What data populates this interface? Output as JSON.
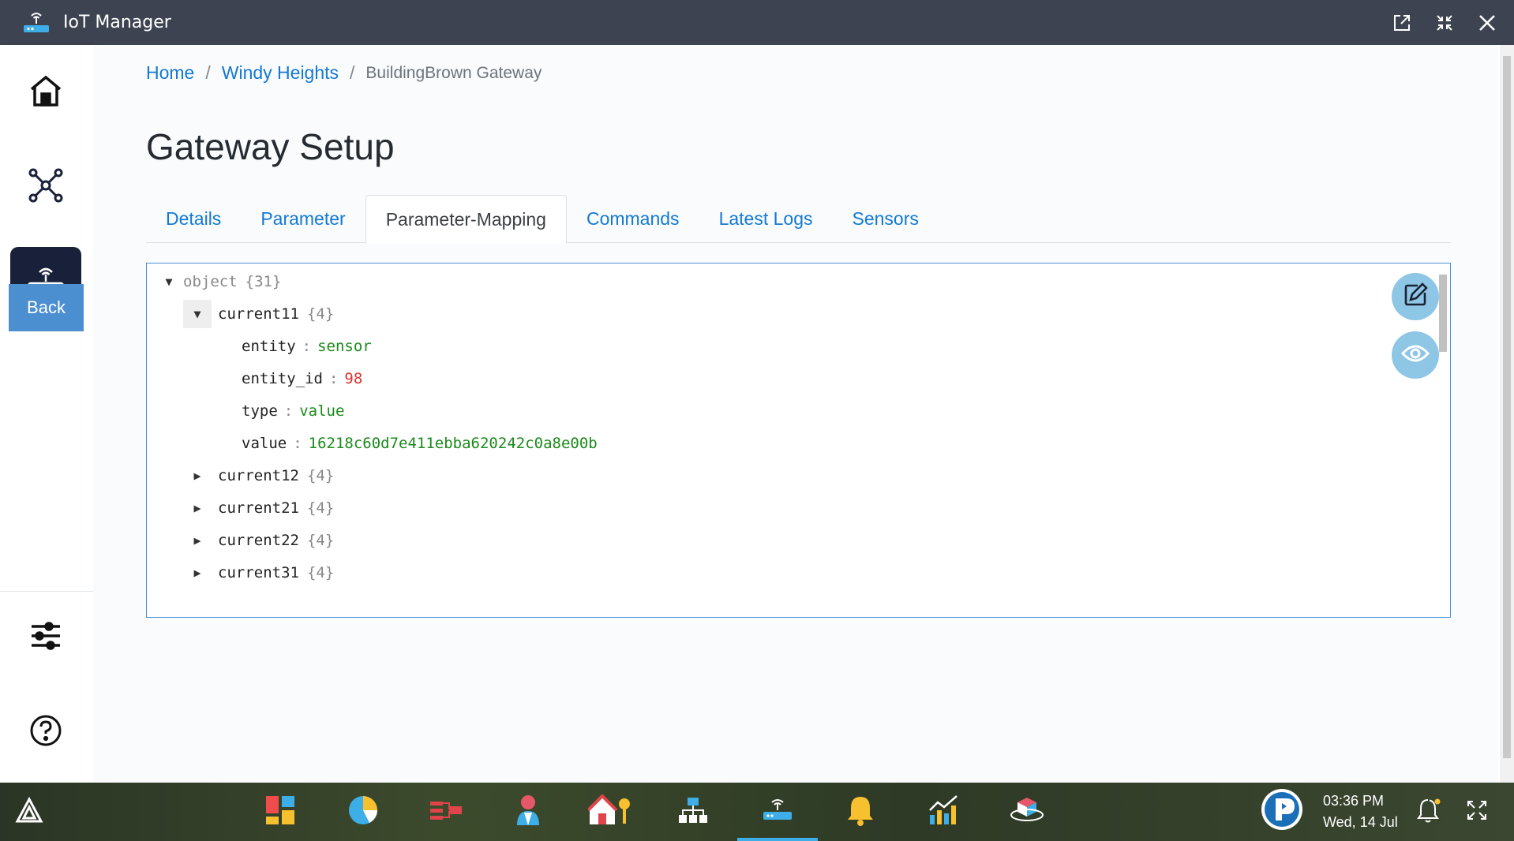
{
  "window": {
    "title": "IoT Manager",
    "controls": [
      "popout-icon",
      "compress-icon",
      "close-icon"
    ]
  },
  "sidebar": {
    "items": [
      {
        "name": "home",
        "icon": "home-icon"
      },
      {
        "name": "network",
        "icon": "network-icon"
      },
      {
        "name": "gateway",
        "icon": "router-icon",
        "active": true
      }
    ],
    "back_label": "Back",
    "bottom_items": [
      {
        "name": "settings",
        "icon": "sliders-icon"
      },
      {
        "name": "help",
        "icon": "help-icon"
      }
    ]
  },
  "breadcrumb": {
    "home": "Home",
    "site": "Windy Heights",
    "current": "BuildingBrown Gateway",
    "separator": "/"
  },
  "page_title": "Gateway Setup",
  "tabs": [
    {
      "label": "Details"
    },
    {
      "label": "Parameter"
    },
    {
      "label": "Parameter-Mapping",
      "active": true
    },
    {
      "label": "Commands"
    },
    {
      "label": "Latest Logs"
    },
    {
      "label": "Sensors"
    }
  ],
  "json_viewer": {
    "root_label": "object",
    "root_count": "{31}",
    "expanded": {
      "key": "current11",
      "count": "{4}",
      "fields": [
        {
          "key": "entity",
          "value": "sensor",
          "kind": "string"
        },
        {
          "key": "entity_id",
          "value": "98",
          "kind": "number"
        },
        {
          "key": "type",
          "value": "value",
          "kind": "string"
        },
        {
          "key": "value",
          "value": "16218c60d7e411ebba620242c0a8e00b",
          "kind": "string"
        }
      ]
    },
    "collapsed": [
      {
        "key": "current12",
        "count": "{4}"
      },
      {
        "key": "current21",
        "count": "{4}"
      },
      {
        "key": "current22",
        "count": "{4}"
      },
      {
        "key": "current31",
        "count": "{4}"
      }
    ],
    "tools": [
      "edit-icon",
      "eye-icon"
    ]
  },
  "taskbar": {
    "apps": [
      "start-icon",
      "dashboard-icon",
      "analytics-icon",
      "flow-icon",
      "user-icon",
      "home-key-icon",
      "hierarchy-icon",
      "gateway-icon",
      "bell-app-icon",
      "chart-icon",
      "cube-icon"
    ],
    "time": "03:36 PM",
    "date": "Wed, 14 Jul"
  }
}
